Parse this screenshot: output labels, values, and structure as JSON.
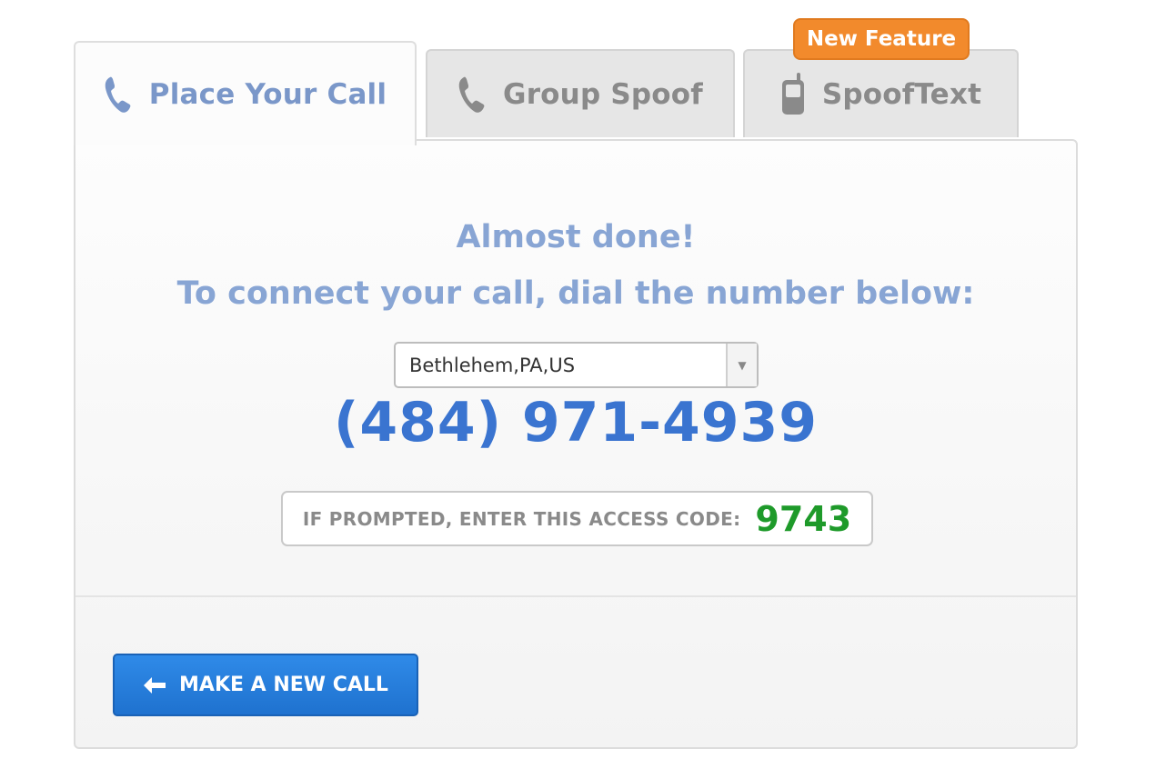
{
  "tabs": {
    "place_call": {
      "label": "Place Your Call",
      "icon": "phone-icon"
    },
    "group_spoof": {
      "label": "Group Spoof",
      "icon": "phone-icon"
    },
    "spoof_text": {
      "label": "SpoofText",
      "icon": "mobile-phone-icon",
      "badge": "New Feature"
    }
  },
  "panel": {
    "heading": "Almost done!",
    "instruction": "To connect your call, dial the number below:",
    "location_select": {
      "selected": "Bethlehem,PA,US"
    },
    "dial_number": "(484) 971-4939",
    "access_code_label": "IF PROMPTED, ENTER THIS ACCESS CODE:",
    "access_code": "9743",
    "new_call_button": "MAKE A NEW CALL"
  },
  "colors": {
    "active_tab_text": "#7a97c9",
    "inactive_tab_text": "#8a8a8a",
    "badge": "#f28a2c",
    "heading": "#88a5d4",
    "phone_number": "#3a74d0",
    "access_code": "#1e9a2a",
    "button": "#1f72cf"
  }
}
